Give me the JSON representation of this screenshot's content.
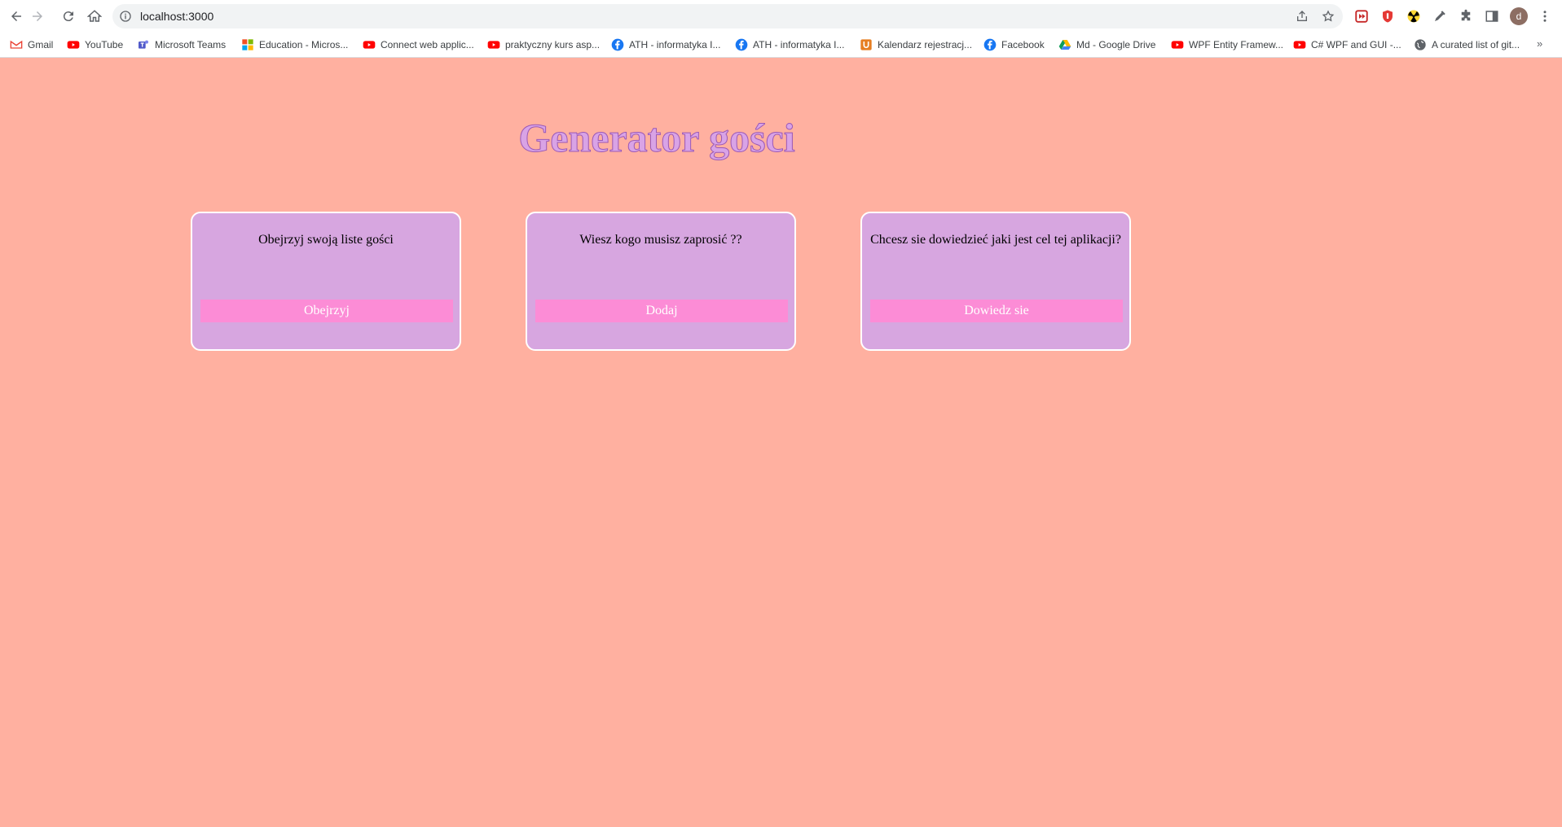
{
  "browser": {
    "url": "localhost:3000",
    "avatar_letter": "d",
    "bookmarks": [
      {
        "label": "Gmail",
        "icon": "gmail-icon"
      },
      {
        "label": "YouTube",
        "icon": "youtube-icon"
      },
      {
        "label": "Microsoft Teams",
        "icon": "teams-icon"
      },
      {
        "label": "Education - Micros...",
        "icon": "microsoft-icon"
      },
      {
        "label": "Connect web applic...",
        "icon": "youtube-icon"
      },
      {
        "label": "praktyczny kurs asp...",
        "icon": "youtube-icon"
      },
      {
        "label": "ATH - informatyka I...",
        "icon": "facebook-icon"
      },
      {
        "label": "ATH - informatyka I...",
        "icon": "facebook-icon"
      },
      {
        "label": "Kalendarz rejestracj...",
        "icon": "u-icon"
      },
      {
        "label": "Facebook",
        "icon": "facebook-icon"
      },
      {
        "label": "Md - Google Drive",
        "icon": "google-drive-icon"
      },
      {
        "label": "WPF Entity Framew...",
        "icon": "youtube-icon"
      },
      {
        "label": "C# WPF and GUI -...",
        "icon": "youtube-icon"
      },
      {
        "label": "A curated list of git...",
        "icon": "globe-icon"
      }
    ],
    "more_label": "»"
  },
  "page": {
    "title": "Generator gości",
    "cards": [
      {
        "text": "Obejrzyj swoją liste gości",
        "button": "Obejrzyj"
      },
      {
        "text": "Wiesz kogo musisz zaprosić ??",
        "button": "Dodaj"
      },
      {
        "text": "Chcesz sie dowiedzieć jaki jest cel tej aplikacji?",
        "button": "Dowiedz sie"
      }
    ]
  },
  "colors": {
    "page_background": "#ffb0a0",
    "card_background": "#d7a6e0",
    "button_background": "#fc8cd6",
    "title_color": "#d9a3e6"
  }
}
